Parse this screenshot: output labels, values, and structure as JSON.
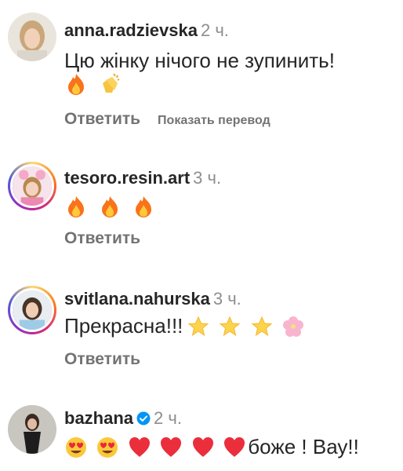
{
  "comments": [
    {
      "username": "anna.radzievska",
      "time": "2 ч.",
      "text": "Цю жінку нічого не зупинить!",
      "emojis": [
        "fire-emoji",
        "clapping-hands-emoji"
      ],
      "reply_label": "Ответить",
      "translate_label": "Показать перевод"
    },
    {
      "username": "tesoro.resin.art",
      "time": "3 ч.",
      "emojis": [
        "fire-emoji",
        "fire-emoji",
        "fire-emoji"
      ],
      "reply_label": "Ответить"
    },
    {
      "username": "svitlana.nahurska",
      "time": "3 ч.",
      "text": "Прекрасна!!!",
      "emojis": [
        "glowing-star-emoji",
        "glowing-star-emoji",
        "glowing-star-emoji",
        "cherry-blossom-emoji"
      ],
      "reply_label": "Ответить"
    },
    {
      "username": "bazhana",
      "time": "2 ч.",
      "verified": true,
      "emojis": [
        "heart-eyes-emoji",
        "heart-eyes-emoji",
        "red-heart-emoji",
        "red-heart-emoji",
        "red-heart-emoji",
        "red-heart-emoji"
      ],
      "text_after": "боже ! Вау!!"
    }
  ]
}
